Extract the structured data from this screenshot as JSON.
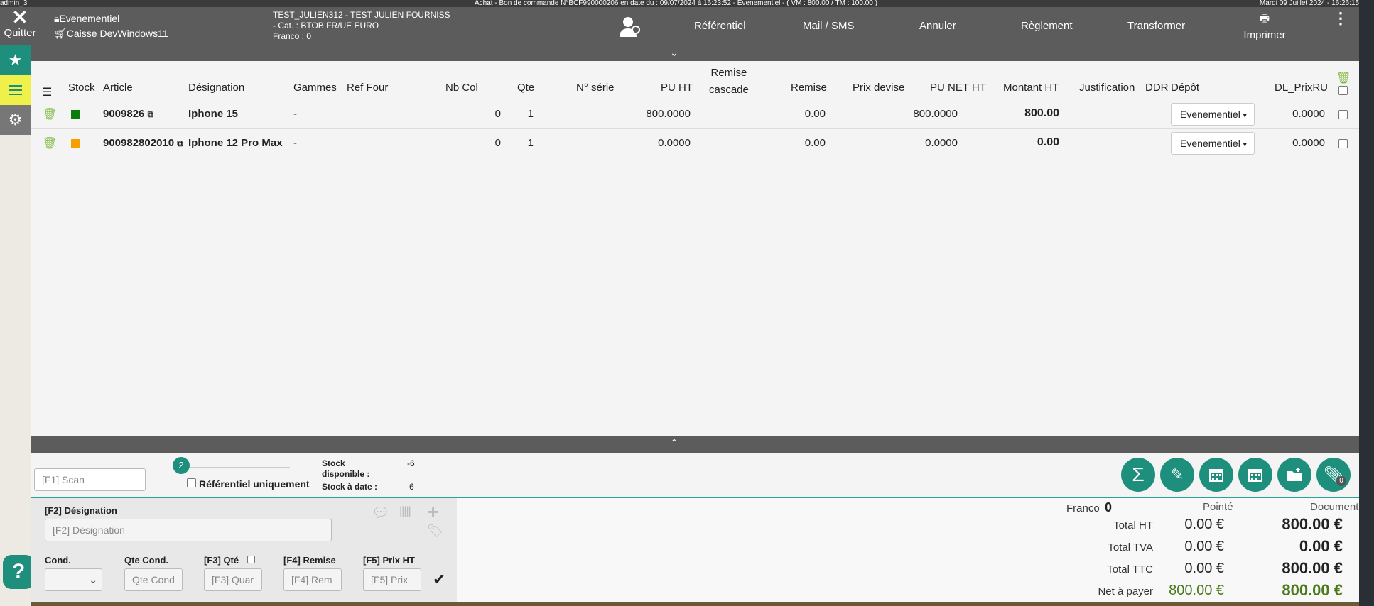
{
  "topbar": {
    "user": "admin_3",
    "title": "Achat - Bon de commande N°BCF990000206 en date du : 09/07/2024 à 16:23:52 - Evenementiel - ( VM : 800.00 / TM : 100.00 )",
    "datetime": "Mardi 09 Juillet 2024 - 16:26:15"
  },
  "header": {
    "quit": "Quitter",
    "store": "Evenementiel",
    "register": "Caisse DevWindows11",
    "supplier_line1": "TEST_JULIEN312 - TEST JULIEN FOURNISS",
    "supplier_line2": "- Cat. : BTOB FR/UE EURO",
    "supplier_line3": "Franco : 0",
    "nav": [
      "Référentiel",
      "Mail / SMS",
      "Annuler",
      "Règlement",
      "Transformer"
    ],
    "print": "Imprimer"
  },
  "columns": {
    "stock": "Stock",
    "article": "Article",
    "designation": "Désignation",
    "gammes": "Gammes",
    "ref_four": "Ref Four",
    "nb_col": "Nb Col",
    "qte": "Qte",
    "serie": "N° série",
    "pu_ht": "PU HT",
    "remise_cascade_1": "Remise",
    "remise_cascade_2": "cascade",
    "remise": "Remise",
    "prix_devise": "Prix devise",
    "pu_net_ht": "PU NET HT",
    "montant_ht": "Montant HT",
    "justification": "Justification",
    "ddr": "DDR",
    "depot": "Dépôt",
    "dl_prixru": "DL_PrixRU"
  },
  "rows": [
    {
      "stock_color": "#0a7a0a",
      "article": "9009826",
      "designation": "Iphone 15",
      "gammes": "-",
      "nb_col": "0",
      "qte": "1",
      "pu_ht": "800.0000",
      "remise": "0.00",
      "pu_net_ht": "800.0000",
      "montant_ht": "800.00",
      "depot": "Evenementiel",
      "dl_prixru": "0.0000"
    },
    {
      "stock_color": "#f5a000",
      "article": "900982802010",
      "designation": "Iphone 12 Pro Max",
      "gammes": "-",
      "nb_col": "0",
      "qte": "1",
      "pu_ht": "0.0000",
      "remise": "0.00",
      "pu_net_ht": "0.0000",
      "montant_ht": "0.00",
      "depot": "Evenementiel",
      "dl_prixru": "0.0000"
    }
  ],
  "scan": {
    "placeholder": "[F1] Scan",
    "badge": "2",
    "ref_only": "Référentiel uniquement",
    "stock_dispo_label": "Stock disponible :",
    "stock_dispo": "-6",
    "stock_date_label": "Stock à date :",
    "stock_date": "6",
    "attach_count": "0"
  },
  "form": {
    "designation_label": "[F2] Désignation",
    "designation_placeholder": "[F2] Désignation",
    "cond_label": "Cond.",
    "qte_cond_label": "Qte Cond.",
    "qte_cond_placeholder": "Qte Cond",
    "qte_label": "[F3] Qté",
    "qte_placeholder": "[F3] Quar",
    "remise_label": "[F4] Remise",
    "remise_placeholder": "[F4] Rem",
    "prix_label": "[F5] Prix HT",
    "prix_placeholder": "[F5] Prix"
  },
  "totals": {
    "franco_label": "Franco",
    "franco_value": "0",
    "col_pointe": "Pointé",
    "col_document": "Document",
    "lines": [
      {
        "label": "Total HT",
        "pointe": "0.00 €",
        "document": "800.00 €"
      },
      {
        "label": "Total TVA",
        "pointe": "0.00 €",
        "document": "0.00 €"
      },
      {
        "label": "Total TTC",
        "pointe": "0.00 €",
        "document": "800.00 €"
      },
      {
        "label": "Net à payer",
        "pointe": "800.00 €",
        "document": "800.00 €"
      }
    ],
    "net_color": "#4a7a1c"
  },
  "colors": {
    "accent": "#1e8f7d",
    "nav_active": "#f0f04a",
    "header_bg": "#5c5c5c"
  }
}
